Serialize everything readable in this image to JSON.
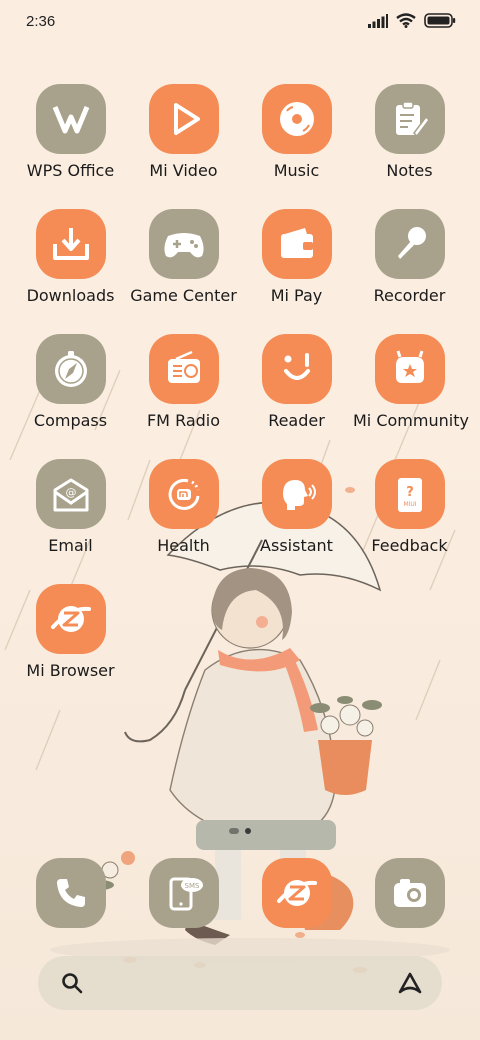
{
  "status": {
    "time": "2:36"
  },
  "apps": [
    {
      "label": "WPS Office",
      "icon": "wps-office-icon",
      "color": "gray"
    },
    {
      "label": "Mi Video",
      "icon": "play-icon",
      "color": "orange"
    },
    {
      "label": "Music",
      "icon": "music-disc-icon",
      "color": "orange"
    },
    {
      "label": "Notes",
      "icon": "notes-icon",
      "color": "gray"
    },
    {
      "label": "Downloads",
      "icon": "download-icon",
      "color": "orange"
    },
    {
      "label": "Game Center",
      "icon": "gamepad-icon",
      "color": "gray"
    },
    {
      "label": "Mi Pay",
      "icon": "wallet-icon",
      "color": "orange"
    },
    {
      "label": "Recorder",
      "icon": "microphone-icon",
      "color": "gray"
    },
    {
      "label": "Compass",
      "icon": "compass-icon",
      "color": "gray"
    },
    {
      "label": "FM Radio",
      "icon": "radio-icon",
      "color": "orange"
    },
    {
      "label": "Reader",
      "icon": "reader-smile-icon",
      "color": "orange"
    },
    {
      "label": "Mi Community",
      "icon": "community-icon",
      "color": "orange"
    },
    {
      "label": "Email",
      "icon": "email-icon",
      "color": "gray"
    },
    {
      "label": "Health",
      "icon": "health-icon",
      "color": "orange"
    },
    {
      "label": "Assistant",
      "icon": "assistant-icon",
      "color": "orange"
    },
    {
      "label": "Feedback",
      "icon": "feedback-icon",
      "color": "orange"
    },
    {
      "label": "Mi Browser",
      "icon": "browser-icon",
      "color": "orange"
    }
  ],
  "feedback_badge_text": "MIUI",
  "sms_badge_text": "SMS",
  "dock": [
    {
      "icon": "phone-icon",
      "color": "gray"
    },
    {
      "icon": "messages-icon",
      "color": "gray"
    },
    {
      "icon": "browser-icon",
      "color": "orange"
    },
    {
      "icon": "camera-icon",
      "color": "gray"
    }
  ],
  "colors": {
    "orange": "#f58c55",
    "gray": "#a8a28c",
    "background": "#fbeee0"
  }
}
